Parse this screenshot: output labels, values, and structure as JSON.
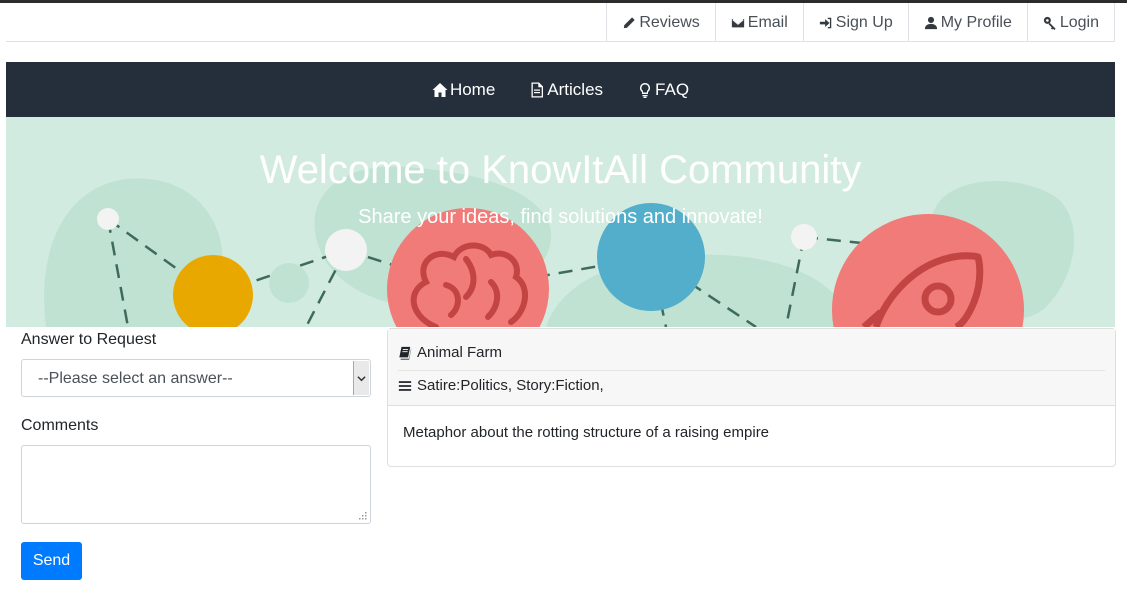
{
  "topnav": {
    "items": [
      {
        "icon": "pencil-icon",
        "label": "Reviews"
      },
      {
        "icon": "envelope-icon",
        "label": "Email"
      },
      {
        "icon": "sign-in-icon",
        "label": "Sign Up"
      },
      {
        "icon": "user-icon",
        "label": "My Profile"
      },
      {
        "icon": "key-icon",
        "label": "Login"
      }
    ]
  },
  "mainnav": {
    "items": [
      {
        "icon": "home-icon",
        "label": "Home"
      },
      {
        "icon": "document-icon",
        "label": "Articles"
      },
      {
        "icon": "lightbulb-icon",
        "label": "FAQ"
      }
    ]
  },
  "hero": {
    "title": "Welcome to KnowItAll Community",
    "subtitle": "Share your ideas, find solutions and innovate!",
    "colors": {
      "background": "#d2ebe0",
      "yellow": "#e8a800",
      "red": "#f07b78",
      "blue": "#52aecb"
    }
  },
  "form": {
    "answer_label": "Answer to Request",
    "answer_select_value": "--Please select an answer--",
    "comments_label": "Comments",
    "comments_value": "",
    "send_label": "Send"
  },
  "card": {
    "title": "Animal Farm",
    "tags": "Satire:Politics, Story:Fiction,",
    "description": "Metaphor about the rotting structure of a raising empire"
  },
  "colors": {
    "navbar": "#252f3b",
    "primary_button": "#007bff"
  }
}
